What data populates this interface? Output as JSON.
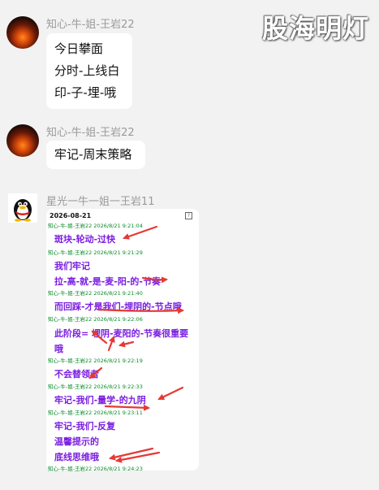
{
  "watermark": "股海明灯",
  "messages": [
    {
      "sender": "知心-牛-姐-王岩22",
      "lines": [
        "今日攀面",
        "分时-上线白",
        "印-子-埋-哦"
      ]
    },
    {
      "sender": "知心-牛-姐-王岩22",
      "lines": [
        "牢记-周末策略"
      ]
    },
    {
      "sender": "星光一牛一姐一王岩11"
    }
  ],
  "card": {
    "date": "2026-08-21",
    "timestamps": [
      "知心-牛-姐-王岩22 2026/8/21 9:21:04",
      "知心-牛-姐-王岩22 2026/8/21 9:21:29",
      "知心-牛-姐-王岩22 2026/8/21 9:21:40",
      "知心-牛-姐-王岩22 2026/8/21 9:22:06",
      "知心-牛-姐-王岩22 2026/8/21 9:22:19",
      "知心-牛-姐-王岩22 2026/8/21 9:22:33",
      "知心-牛-姐-王岩22 2026/8/21 9:23:11",
      "知心-牛-姐-王岩22 2026/8/21 9:24:23"
    ],
    "notes": [
      "斑块-轮动-过快",
      "我们牢记",
      "拉-高-就-是-麦-阳-的-节奏",
      "而回踩-才是我们-埋阴的-节点哦",
      "此阶段= 埋阴-麦阳的-节奏很重要",
      "哦",
      "不会替领者",
      "牢记-我们-量学-的九阴",
      "牢记-我们-反复",
      "温馨提示的",
      "底线思维哦"
    ]
  },
  "colors": {
    "note": "#7a1de0",
    "arrow": "#e53935",
    "timestamp": "#0a8a2a"
  }
}
